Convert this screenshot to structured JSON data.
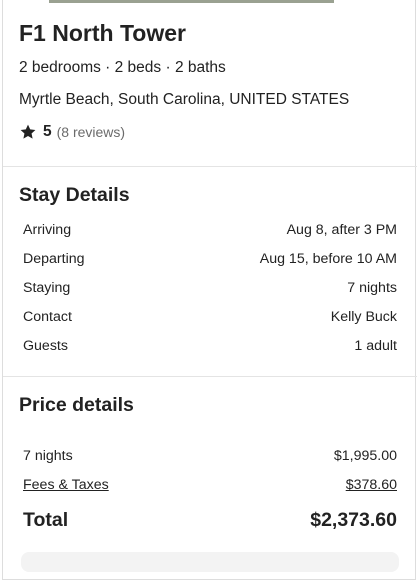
{
  "property": {
    "title": "F1 North Tower",
    "meta": "2 bedrooms · 2 beds · 2 baths",
    "location": "Myrtle Beach, South Carolina, UNITED STATES",
    "rating": "5",
    "reviews": "(8 reviews)"
  },
  "stay": {
    "heading": "Stay Details",
    "rows": [
      {
        "label": "Arriving",
        "value": "Aug 8, after 3 PM"
      },
      {
        "label": "Departing",
        "value": "Aug 15, before 10 AM"
      },
      {
        "label": "Staying",
        "value": "7 nights"
      },
      {
        "label": "Contact",
        "value": "Kelly Buck"
      },
      {
        "label": "Guests",
        "value": "1 adult"
      }
    ]
  },
  "price": {
    "heading": "Price details",
    "nights_label": "7 nights",
    "nights_value": "$1,995.00",
    "fees_label": "Fees & Taxes",
    "fees_value": "$378.60",
    "total_label": "Total",
    "total_value": "$2,373.60"
  },
  "colors": {
    "text": "#222222",
    "muted": "#6b6b6b",
    "border": "#dddddd"
  },
  "icons": {
    "rating": "star-icon"
  }
}
